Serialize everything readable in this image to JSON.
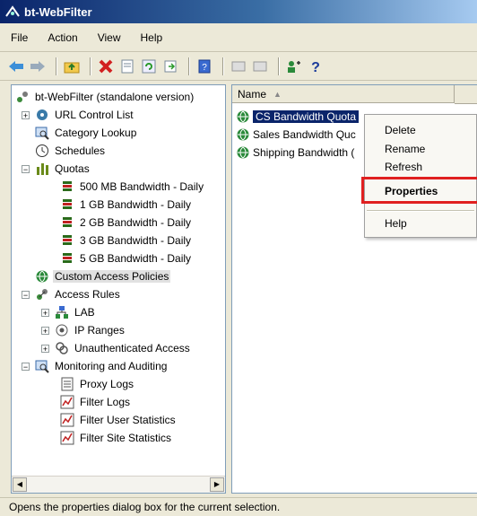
{
  "window": {
    "title": "bt-WebFilter"
  },
  "menu": {
    "file": "File",
    "action": "Action",
    "view": "View",
    "help": "Help"
  },
  "toolbar": {
    "icons": [
      "back-arrow-icon",
      "forward-arrow-icon",
      "up-folder-icon",
      "delete-icon",
      "properties-icon",
      "refresh-icon",
      "export-icon",
      "help-book-icon",
      "action-icon-1",
      "action-icon-2",
      "user-icon",
      "help-icon"
    ]
  },
  "tree": {
    "root": "bt-WebFilter (standalone version)",
    "url_control_list": "URL Control List",
    "category_lookup": "Category Lookup",
    "schedules": "Schedules",
    "quotas": "Quotas",
    "quota_items": [
      "500 MB Bandwidth - Daily",
      "1 GB Bandwidth - Daily",
      "2 GB Bandwidth - Daily",
      "3 GB Bandwidth - Daily",
      "5 GB Bandwidth - Daily"
    ],
    "custom_access_policies": "Custom Access Policies",
    "access_rules": "Access Rules",
    "access_rule_items": [
      "LAB",
      "IP Ranges",
      "Unauthenticated Access"
    ],
    "monitoring": "Monitoring and Auditing",
    "monitoring_items": [
      "Proxy Logs",
      "Filter Logs",
      "Filter User Statistics",
      "Filter Site Statistics"
    ]
  },
  "list": {
    "column_name": "Name",
    "rows": [
      "CS Bandwidth Quota",
      "Sales Bandwidth Quc",
      "Shipping Bandwidth ("
    ]
  },
  "context_menu": {
    "delete": "Delete",
    "rename": "Rename",
    "refresh": "Refresh",
    "properties": "Properties",
    "help": "Help"
  },
  "status": {
    "text": "Opens the properties dialog box for the current selection."
  },
  "colors": {
    "titlebar_start": "#0a246a",
    "selection": "#0a246a",
    "highlight_box": "#e02020"
  }
}
